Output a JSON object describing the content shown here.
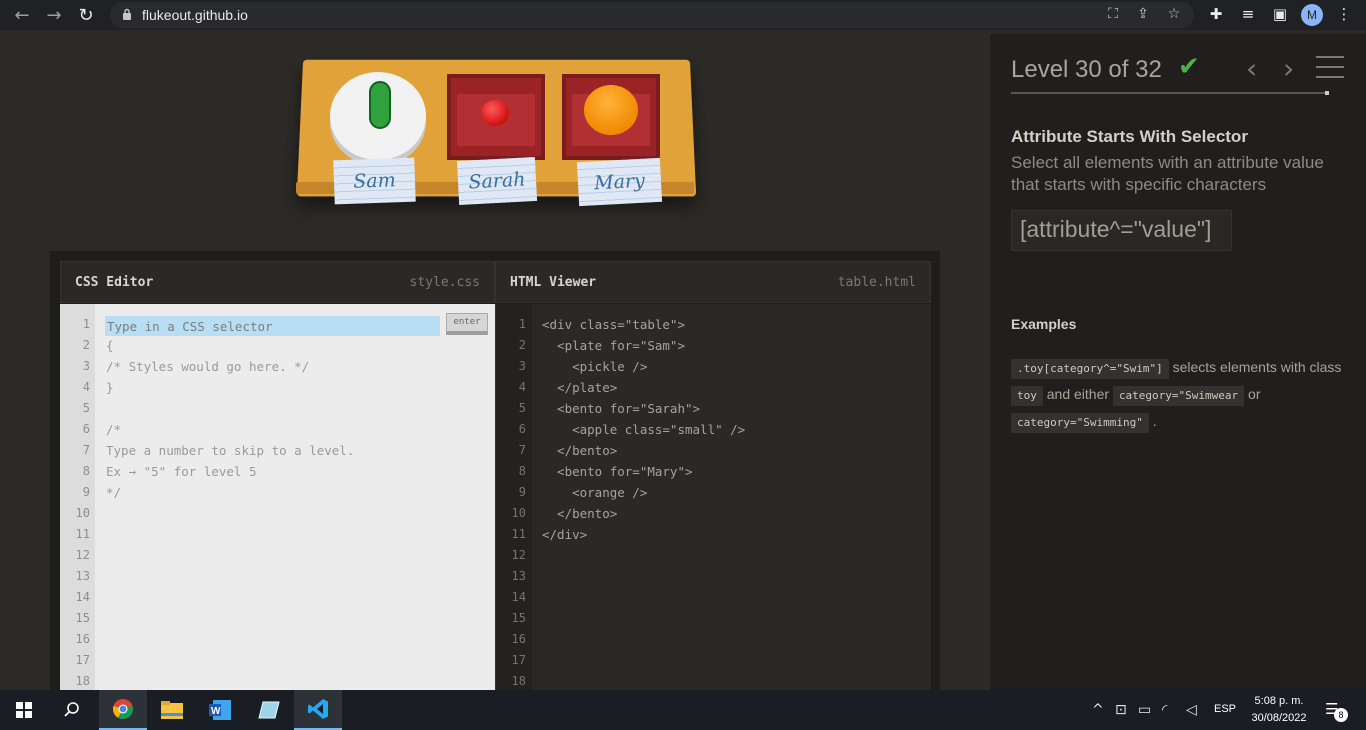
{
  "browser": {
    "url": "flukeout.github.io",
    "icons": [
      "back-arrow-icon",
      "forward-arrow-icon",
      "reload-icon",
      "lock-icon",
      "translate-icon",
      "share-icon",
      "star-icon",
      "extensions-icon",
      "media-icon",
      "side-panel-icon",
      "menu-icon"
    ],
    "avatar_initial": "M"
  },
  "illustration": {
    "tags": [
      "Sam",
      "Sarah",
      "Mary"
    ]
  },
  "css_editor": {
    "title": "CSS Editor",
    "file": "style.css",
    "input_placeholder": "Type in a CSS selector",
    "enter_label": "enter",
    "lines": [
      "{",
      "/* Styles would go here. */",
      "}",
      "",
      "/*",
      "Type a number to skip to a level.",
      "Ex → \"5\" for level 5",
      "*/"
    ],
    "line_count": 18
  },
  "html_viewer": {
    "title": "HTML Viewer",
    "file": "table.html",
    "lines": [
      "<div class=\"table\">",
      "  <plate for=\"Sam\">",
      "    <pickle />",
      "  </plate>",
      "  <bento for=\"Sarah\">",
      "    <apple class=\"small\" />",
      "  </bento>",
      "  <bento for=\"Mary\">",
      "    <orange />",
      "  </bento>",
      "</div>"
    ],
    "line_count": 18
  },
  "sidebar": {
    "level_text": "Level 30 of 32",
    "level_complete_icon": "check-icon",
    "progress_fraction": 0.9375,
    "selector_name": "Attribute Starts With Selector",
    "selector_description": "Select all elements with an attribute value that starts with specific characters",
    "selector_syntax": "[attribute^=\"value\"]",
    "examples_heading": "Examples",
    "example": {
      "code1": ".toy[category^=\"Swim\"]",
      "text1": " selects elements with class ",
      "code2": "toy",
      "text2": " and either ",
      "code3": "category=\"Swimwear",
      "text3": " or ",
      "code4": "category=\"Swimming\"",
      "text4": " ."
    }
  },
  "taskbar": {
    "apps": [
      "start-icon",
      "search-icon",
      "chrome-icon",
      "file-explorer-icon",
      "word-icon",
      "notepad-icon",
      "vscode-icon"
    ],
    "language": "ESP",
    "time": "5:08 p. m.",
    "date": "30/08/2022",
    "notification_count": "8"
  }
}
